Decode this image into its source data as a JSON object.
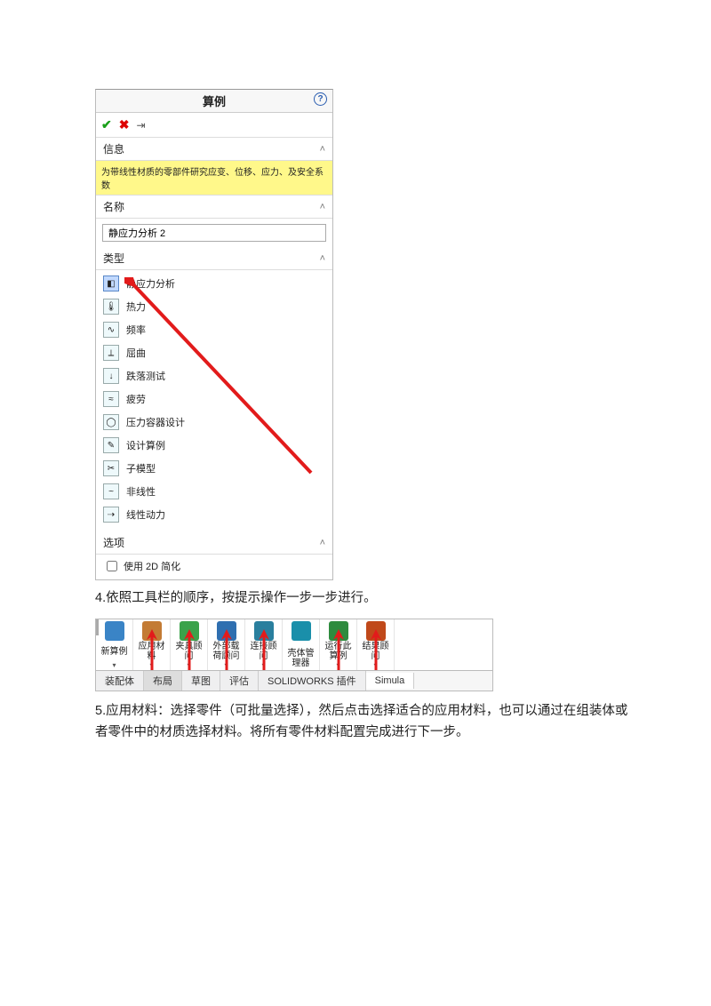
{
  "panel": {
    "title": "算例",
    "help_tip": "?",
    "sections": {
      "info": {
        "header": "信息",
        "highlight": "为带线性材质的零部件研究应变、位移、应力、及安全系数"
      },
      "name": {
        "header": "名称",
        "value": "静应力分析 2"
      },
      "type": {
        "header": "类型",
        "items": [
          {
            "label": "静应力分析",
            "glyph": "◧",
            "selected": true
          },
          {
            "label": "热力",
            "glyph": "🌡"
          },
          {
            "label": "频率",
            "glyph": "∿"
          },
          {
            "label": "屈曲",
            "glyph": "⟂"
          },
          {
            "label": "跌落测试",
            "glyph": "↓"
          },
          {
            "label": "疲劳",
            "glyph": "≈"
          },
          {
            "label": "压力容器设计",
            "glyph": "◯"
          },
          {
            "label": "设计算例",
            "glyph": "✎"
          },
          {
            "label": "子模型",
            "glyph": "✂"
          },
          {
            "label": "非线性",
            "glyph": "~"
          },
          {
            "label": "线性动力",
            "glyph": "⇢"
          }
        ]
      },
      "options": {
        "header": "选项",
        "checkbox": "使用 2D 简化"
      }
    }
  },
  "text": {
    "step4": "4.依照工具栏的顺序，按提示操作一步一步进行。",
    "step5": "5.应用材料：选择零件（可批量选择），然后点击选择适合的应用材料，也可以通过在组装体或者零件中的材质选择材料。将所有零件材料配置完成进行下一步。"
  },
  "toolbar": {
    "buttons": [
      {
        "label": "新算例",
        "color": "#3a84c6",
        "arrow": false,
        "drop": true
      },
      {
        "label": "应用材\n料",
        "color": "#c37b34",
        "arrow": true,
        "drop": true
      },
      {
        "label": "夹具顾\n问",
        "color": "#3aa24a",
        "arrow": true,
        "drop": true
      },
      {
        "label": "外部载\n荷顾问",
        "color": "#2f6fb0",
        "arrow": true,
        "drop": true
      },
      {
        "label": "连接顾\n问",
        "color": "#2a7f9e",
        "arrow": true,
        "drop": true
      },
      {
        "label": "壳体管\n理器",
        "color": "#1a8faa",
        "arrow": false,
        "drop": false
      },
      {
        "label": "运行此\n算例",
        "color": "#2e8b3e",
        "arrow": true,
        "drop": true
      },
      {
        "label": "结果顾\n问",
        "color": "#c0491a",
        "arrow": true,
        "drop": true
      }
    ],
    "tabs": [
      "装配体",
      "布局",
      "草图",
      "评估",
      "SOLIDWORKS 插件",
      "Simula"
    ]
  }
}
